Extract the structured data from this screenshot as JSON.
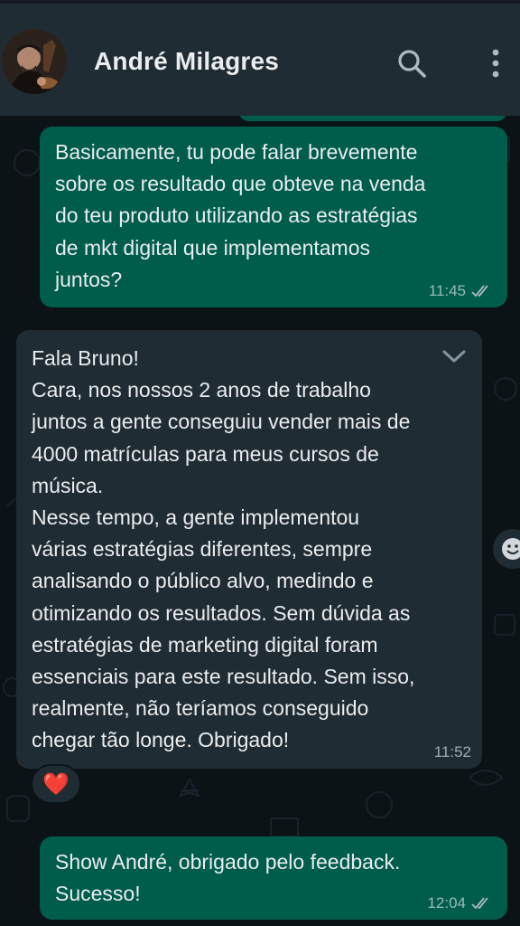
{
  "header": {
    "contact_name": "André Milagres",
    "icons": [
      "avatar",
      "search-icon",
      "menu-icon"
    ]
  },
  "messages": [
    {
      "direction": "outgoing",
      "text": "Basicamente, tu pode falar brevemente\nsobre os resultado que obteve na venda\ndo teu produto utilizando as estratégias\nde mkt digital que implementamos\njuntos?",
      "time": "11:45",
      "status": "read"
    },
    {
      "direction": "incoming",
      "text": "Fala Bruno!\nCara, nos nossos 2 anos de trabalho\njuntos a gente conseguiu vender mais de\n4000 matrículas para meus cursos de\nmúsica.\nNesse tempo, a gente implementou\nvárias estratégias diferentes, sempre\nanalisando o público alvo, medindo e\notimizando os resultados. Sem dúvida as\nestratégias de marketing digital foram\nessenciais para este resultado. Sem isso,\nrealmente, não teríamos conseguido\nchegar tão longe. Obrigado!",
      "time": "11:52",
      "reaction": "❤️"
    },
    {
      "direction": "outgoing",
      "text": "Show André, obrigado pelo feedback.\nSucesso!",
      "time": "12:04",
      "status": "read"
    }
  ],
  "colors": {
    "header_bg": "#202c33",
    "chat_bg": "#0c1317",
    "outgoing_bubble": "#005c4b",
    "incoming_bubble": "#202c33",
    "text": "#e9edef"
  }
}
